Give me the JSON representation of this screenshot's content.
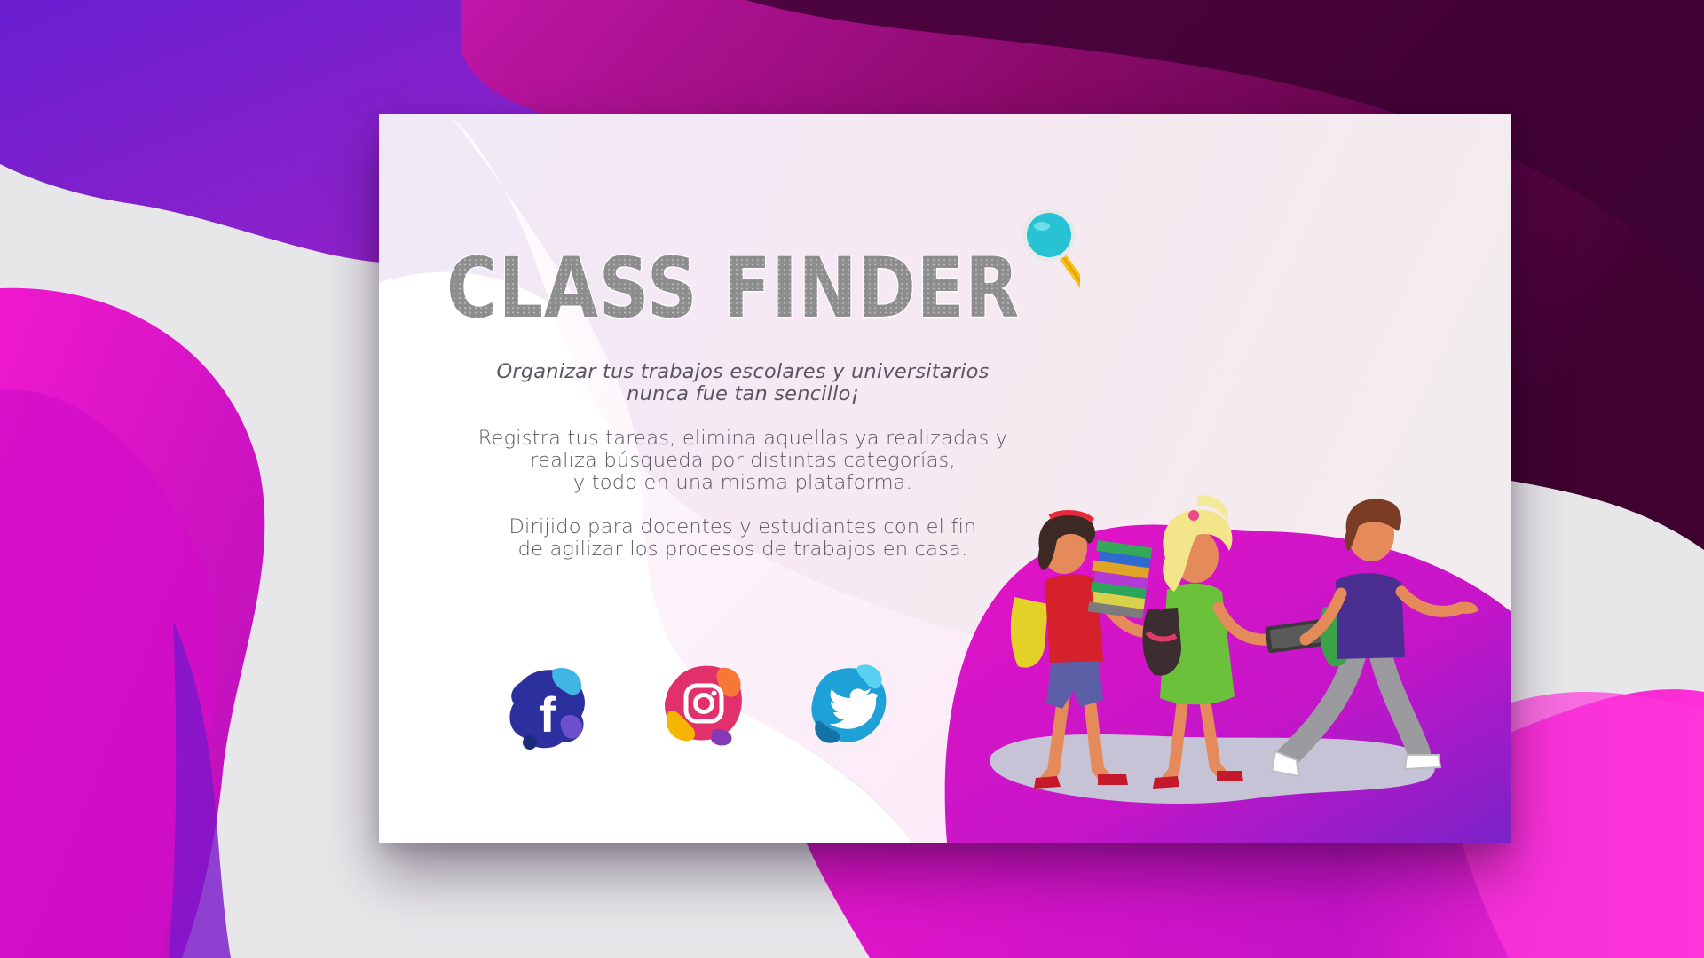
{
  "app": {
    "title": "CLASS FINDER",
    "title_icon": "magnifier-icon"
  },
  "intro": {
    "tagline_line1": "Organizar tus trabajos escolares y universitarios",
    "tagline_line2": "nunca fue tan sencillo¡",
    "features_line1": "Registra tus tareas, elimina aquellas ya realizadas y",
    "features_line2": "realiza búsqueda por distintas categorías,",
    "features_line3": "y todo en una misma plataforma.",
    "audience_line1": "Dirijido para docentes y estudiantes con el fin",
    "audience_line2": "de agilizar los procesos de trabajos en casa."
  },
  "social": [
    {
      "name": "facebook",
      "icon": "facebook-icon",
      "color": "#3b3da8"
    },
    {
      "name": "instagram",
      "icon": "instagram-icon",
      "color": "#e33f72"
    },
    {
      "name": "twitter",
      "icon": "twitter-icon",
      "color": "#2aa7d6"
    }
  ],
  "colors": {
    "accent_magenta": "#e213c9",
    "accent_purple": "#7f1fc7",
    "dark_plum": "#4a0535",
    "title_gray": "#8c8c8c"
  }
}
